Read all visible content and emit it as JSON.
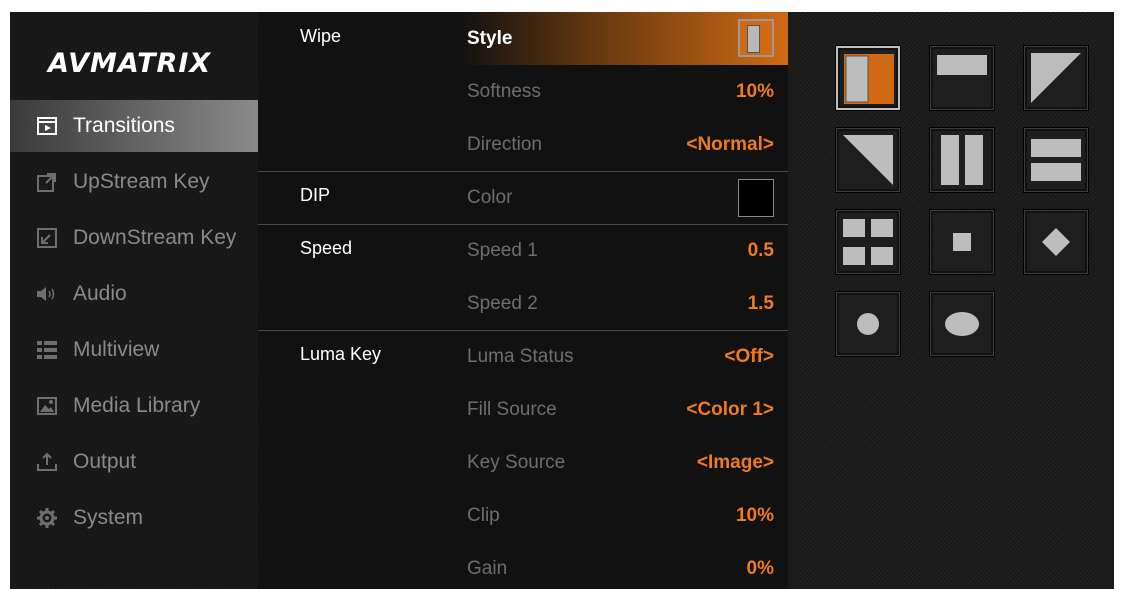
{
  "brand": {
    "logo_text": "AVMATRIX"
  },
  "sidebar": {
    "items": [
      {
        "label": "Transitions",
        "icon": "transitions-icon",
        "active": true
      },
      {
        "label": "UpStream Key",
        "icon": "upstream-key-icon"
      },
      {
        "label": "DownStream Key",
        "icon": "downstream-key-icon"
      },
      {
        "label": "Audio",
        "icon": "audio-icon"
      },
      {
        "label": "Multiview",
        "icon": "multiview-icon"
      },
      {
        "label": "Media Library",
        "icon": "media-library-icon"
      },
      {
        "label": "Output",
        "icon": "output-icon"
      },
      {
        "label": "System",
        "icon": "gear-icon"
      }
    ]
  },
  "settings": {
    "groups": {
      "wipe": "Wipe",
      "dip": "DIP",
      "speed": "Speed",
      "luma_key": "Luma Key"
    },
    "rows": [
      {
        "param": "Style",
        "value": ""
      },
      {
        "param": "Softness",
        "value": "10%"
      },
      {
        "param": "Direction",
        "value": "<Normal>"
      },
      {
        "param": "Color",
        "value": ""
      },
      {
        "param": "Speed 1",
        "value": "0.5"
      },
      {
        "param": "Speed 2",
        "value": "1.5"
      },
      {
        "param": "Luma Status",
        "value": "<Off>"
      },
      {
        "param": "Fill Source",
        "value": "<Color 1>"
      },
      {
        "param": "Key Source",
        "value": "<Image>"
      },
      {
        "param": "Clip",
        "value": "10%"
      },
      {
        "param": "Gain",
        "value": "0%"
      }
    ]
  },
  "wipe_styles": [
    {
      "icon": "vertical-wipe-icon",
      "selected": true
    },
    {
      "icon": "horizontal-bar-wipe-icon"
    },
    {
      "icon": "diagonal-top-right-wipe-icon"
    },
    {
      "icon": "diagonal-bottom-left-wipe-icon"
    },
    {
      "icon": "vertical-split-wipe-icon"
    },
    {
      "icon": "horizontal-split-wipe-icon"
    },
    {
      "icon": "four-corner-wipe-icon"
    },
    {
      "icon": "box-wipe-icon"
    },
    {
      "icon": "diamond-wipe-icon"
    },
    {
      "icon": "circle-wipe-icon"
    },
    {
      "icon": "ellipse-wipe-icon"
    }
  ],
  "colors": {
    "accent": "#f07a1e",
    "selected_gradient": "#d06a14",
    "dip_color": "#000000"
  }
}
